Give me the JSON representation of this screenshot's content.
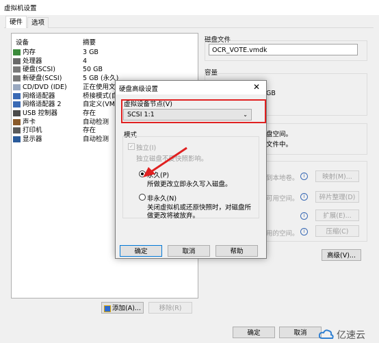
{
  "window": {
    "title": "虚拟机设置"
  },
  "tabs": [
    {
      "label": "硬件"
    },
    {
      "label": "选项"
    }
  ],
  "device_list": {
    "headers": {
      "device": "设备",
      "summary": "摘要"
    },
    "rows": [
      {
        "name": "内存",
        "summary": "3 GB",
        "icon": "memory-icon"
      },
      {
        "name": "处理器",
        "summary": "4",
        "icon": "processor-icon"
      },
      {
        "name": "硬盘(SCSI)",
        "summary": "50 GB",
        "icon": "harddisk-icon"
      },
      {
        "name": "新硬盘(SCSI)",
        "summary": "5 GB (永久)",
        "icon": "harddisk-icon"
      },
      {
        "name": "CD/DVD (IDE)",
        "summary": "正在使用文",
        "icon": "cd-dvd-icon"
      },
      {
        "name": "网络适配器",
        "summary": "桥接模式(自",
        "icon": "network-adapter-icon"
      },
      {
        "name": "网络适配器 2",
        "summary": "自定义(VMn",
        "icon": "network-adapter-icon"
      },
      {
        "name": "USB 控制器",
        "summary": "存在",
        "icon": "usb-icon"
      },
      {
        "name": "声卡",
        "summary": "自动检测",
        "icon": "sound-card-icon"
      },
      {
        "name": "打印机",
        "summary": "存在",
        "icon": "printer-icon"
      },
      {
        "name": "显示器",
        "summary": "自动检测",
        "icon": "display-icon"
      }
    ],
    "add_label": "添加(A)...",
    "remove_label": "移除(R)"
  },
  "disk_file": {
    "label": "磁盘文件",
    "value": "OCR_VOTE.vmdk"
  },
  "capacity": {
    "label": "容量",
    "size_suffix": "GB"
  },
  "disk_info": {
    "line1": "盘空间。",
    "line2": "文件中。"
  },
  "utilities": {
    "rows": [
      {
        "text": "到本地卷。",
        "button": "映射(M)..."
      },
      {
        "text": "可用空间。",
        "button": "碎片整理(D)"
      },
      {
        "text": "",
        "button": "扩展(E)..."
      },
      {
        "text": "用的空间。",
        "button": "压缩(C)"
      }
    ],
    "advanced": "高级(V)..."
  },
  "footer": {
    "ok": "确定",
    "cancel": "取消"
  },
  "dialog": {
    "title": "硬盘高级设置",
    "node_label": "虚拟设备节点(V)",
    "node_value": "SCSI 1:1",
    "mode_label": "模式",
    "independent": "独立(I)",
    "independent_desc": "独立磁盘不受快照影响。",
    "persistent": "永久(P)",
    "persistent_desc": "所做更改立即永久写入磁盘。",
    "nonpersistent": "非永久(N)",
    "nonpersistent_desc1": "关闭虚拟机或还原快照时，对磁盘所",
    "nonpersistent_desc2": "做更改将被放弃。",
    "ok": "确定",
    "cancel": "取消",
    "help": "帮助"
  },
  "watermark": "亿速云",
  "colors": {
    "highlight_box": "#e02020",
    "accent": "#0078d7"
  }
}
